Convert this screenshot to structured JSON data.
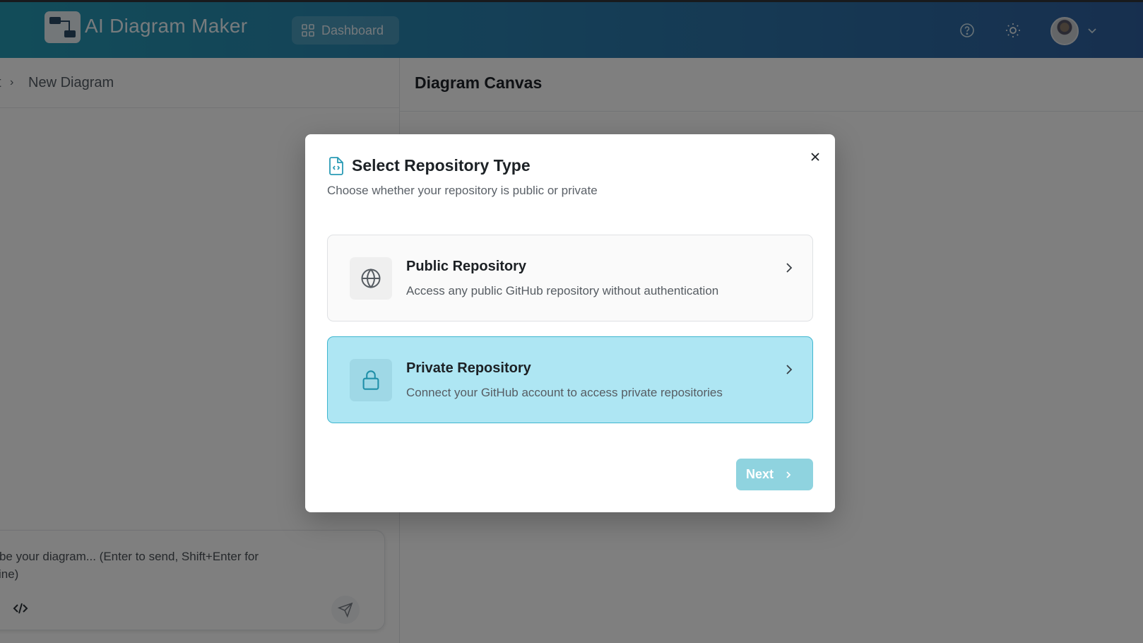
{
  "header": {
    "app_title": "AI Diagram Maker",
    "dashboard_label": "Dashboard"
  },
  "breadcrumb": {
    "prev": "t",
    "separator": "›",
    "current": "New Diagram"
  },
  "chat": {
    "placeholder": "cribe your diagram... (Enter to send, Shift+Enter for\nv line)"
  },
  "canvas": {
    "title": "Diagram Canvas"
  },
  "modal": {
    "title": "Select Repository Type",
    "subtitle": "Choose whether your repository is public or private",
    "options": [
      {
        "title": "Public Repository",
        "description": "Access any public GitHub repository without authentication",
        "icon": "globe-icon",
        "selected": false
      },
      {
        "title": "Private Repository",
        "description": "Connect your GitHub account to access private repositories",
        "icon": "lock-icon",
        "selected": true
      }
    ],
    "next_label": "Next"
  },
  "colors": {
    "accent": "#2a9bb5",
    "selected_bg": "#aee6f3",
    "selected_border": "#3fb6cf",
    "next_btn": "#8fd3df"
  }
}
